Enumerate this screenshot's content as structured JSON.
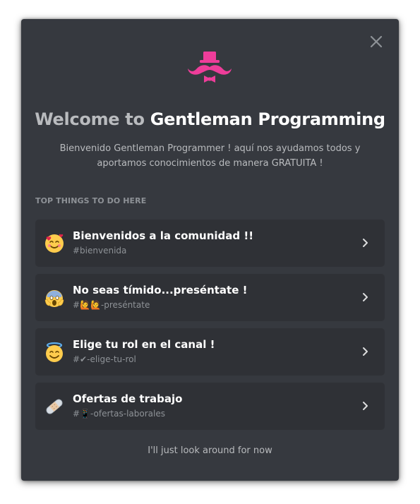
{
  "modal": {
    "close_icon": "close-icon",
    "logo_icon": "mustache-hat-logo",
    "accent_color": "#ee3d9a",
    "title_prefix": "Welcome to ",
    "server_name": "Gentleman Programming",
    "description": "Bienvenido Gentleman Programmer ! aquí nos ayudamos todos y aportamos conocimientos de manera GRATUITA !",
    "section_header": "TOP THINGS TO DO HERE",
    "items": [
      {
        "emoji": "smiling-face-with-hearts",
        "title": "Bienvenidos a la comunidad !!",
        "channel": "#bienvenida"
      },
      {
        "emoji": "face-screaming-in-fear",
        "title": "No seas tímido...preséntate !",
        "channel": "#🙋🙋-preséntate"
      },
      {
        "emoji": "smiling-face-with-halo",
        "title": "Elige tu rol en el canal !",
        "channel": "#✔-elige-tu-rol"
      },
      {
        "emoji": "adhesive-bandage",
        "title": "Ofertas de trabajo",
        "channel": "#📱-ofertas-laborales"
      }
    ],
    "footer_link": "I'll just look around for now",
    "chevron_icon": "chevron-right-icon"
  }
}
